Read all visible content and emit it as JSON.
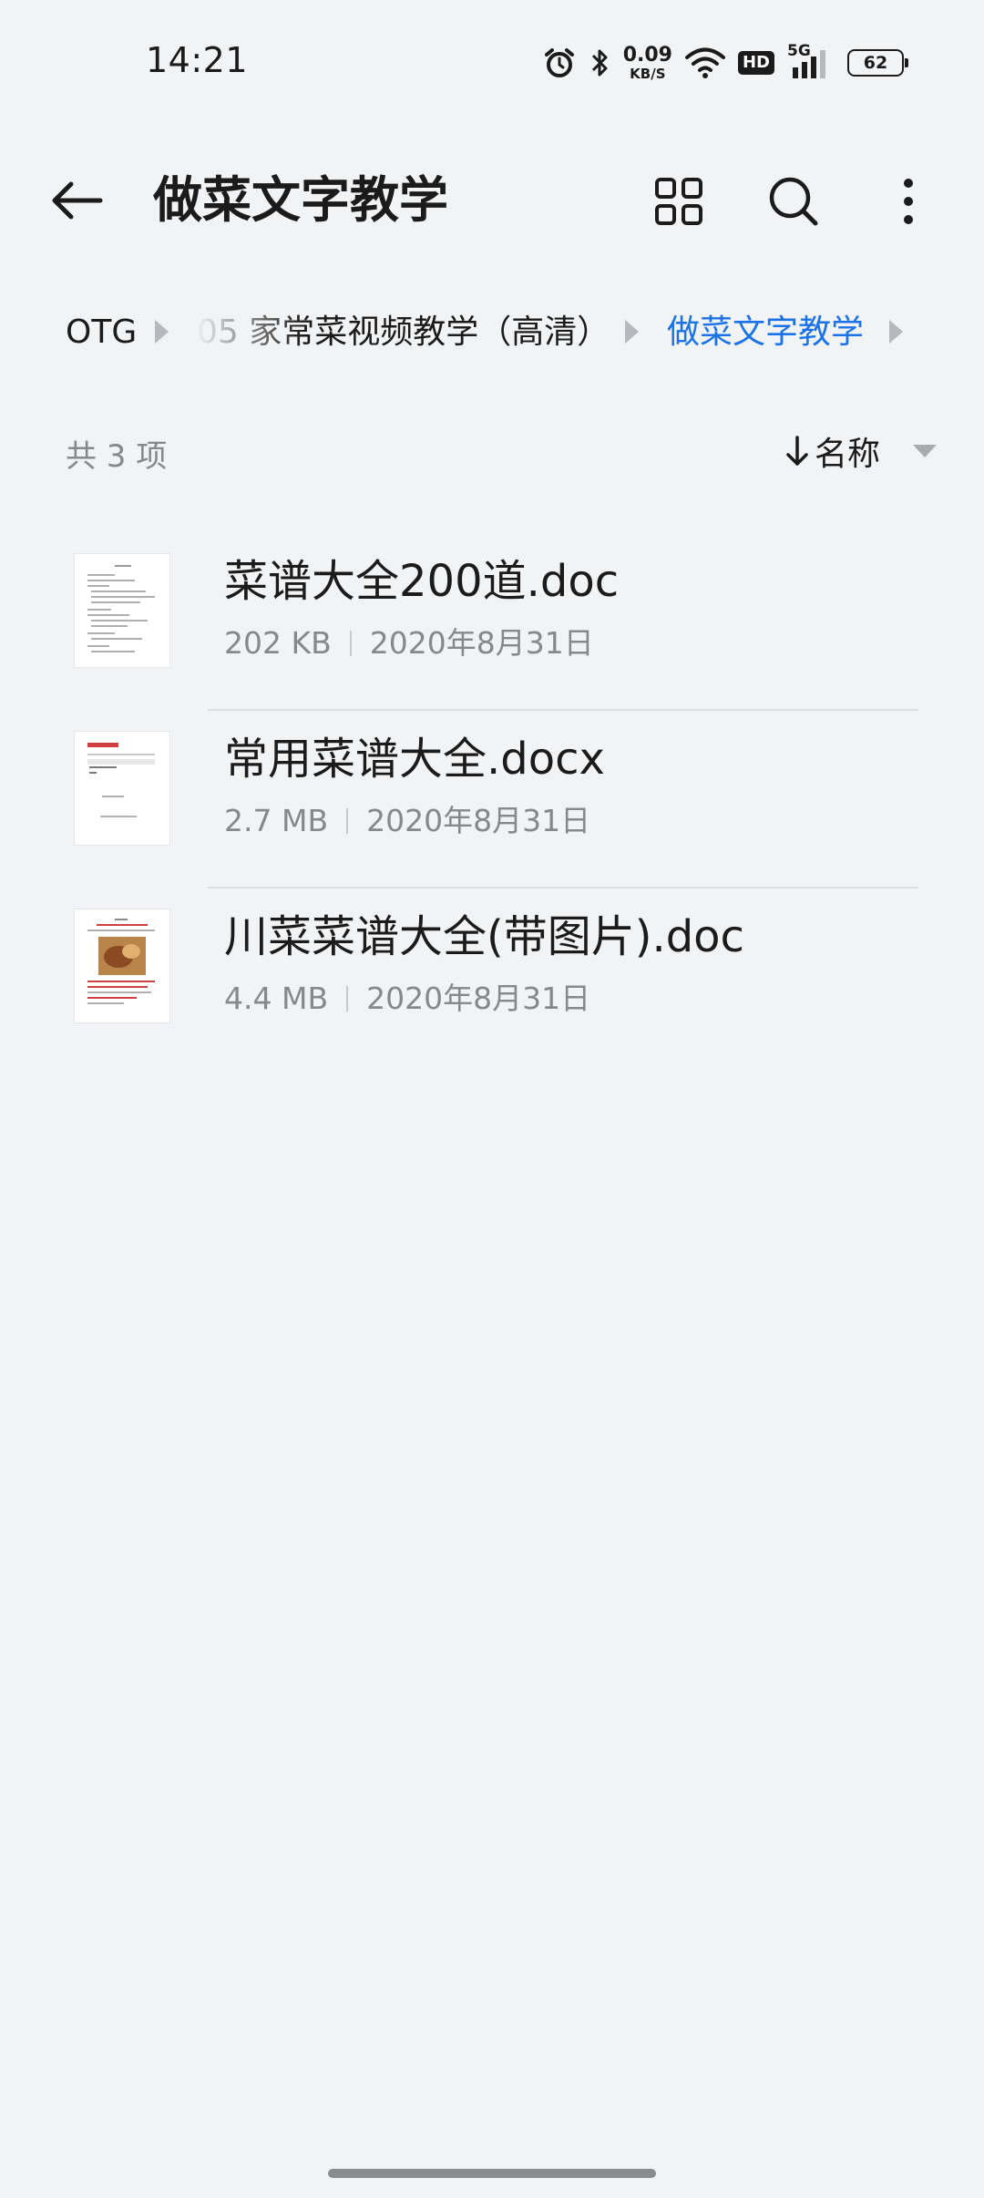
{
  "status_bar": {
    "time": "14:21",
    "net_speed_value": "0.09",
    "net_speed_unit": "KB/S",
    "hd_label": "HD",
    "network_label": "5G",
    "battery_level": "62",
    "icons": [
      "alarm-icon",
      "bluetooth-icon",
      "wifi-icon",
      "signal-icon"
    ]
  },
  "app_bar": {
    "title": "做菜文字教学",
    "actions": [
      "grid-view-icon",
      "search-icon",
      "more-vert-icon"
    ]
  },
  "breadcrumb": {
    "items": [
      "OTG",
      "05 家常菜视频教学（高清）",
      "做菜文字教学"
    ],
    "active_color": "#1a73e8"
  },
  "list_header": {
    "count_label": "共 3 项",
    "sort_label": "名称"
  },
  "files": [
    {
      "name": "菜谱大全200道.doc",
      "size": "202 KB",
      "date": "2020年8月31日"
    },
    {
      "name": "常用菜谱大全.docx",
      "size": "2.7 MB",
      "date": "2020年8月31日"
    },
    {
      "name": "川菜菜谱大全(带图片).doc",
      "size": "4.4 MB",
      "date": "2020年8月31日"
    }
  ]
}
